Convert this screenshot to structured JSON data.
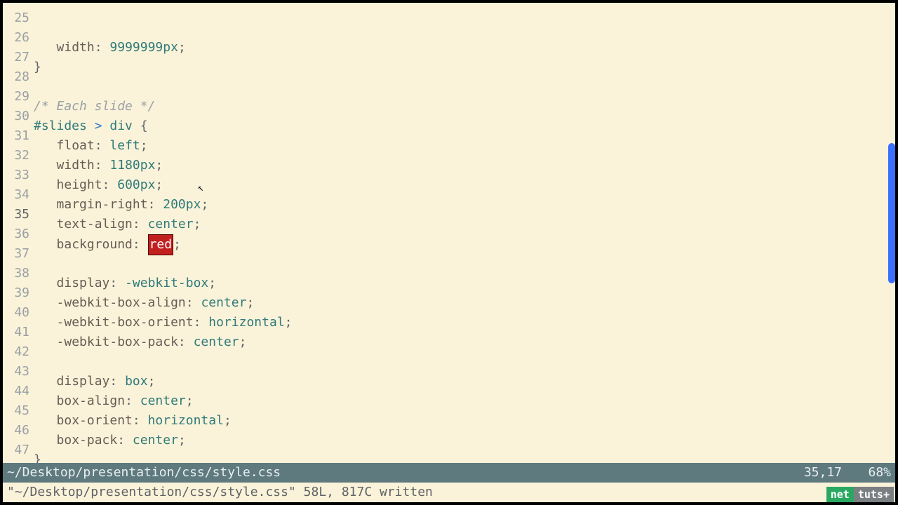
{
  "lines": [
    {
      "n": 25,
      "indent": 1,
      "tokens": [
        {
          "t": "width",
          "c": "prop"
        },
        {
          "t": ": ",
          "c": "punct"
        },
        {
          "t": "9999999px",
          "c": "num"
        },
        {
          "t": ";",
          "c": "punct"
        }
      ]
    },
    {
      "n": 26,
      "indent": 0,
      "tokens": [
        {
          "t": "}",
          "c": "punct"
        }
      ]
    },
    {
      "n": 27,
      "indent": 0,
      "tokens": []
    },
    {
      "n": 28,
      "indent": 0,
      "tokens": [
        {
          "t": "/* Each slide */",
          "c": "comment"
        }
      ]
    },
    {
      "n": 29,
      "indent": 0,
      "tokens": [
        {
          "t": "#slides",
          "c": "kw"
        },
        {
          "t": " > ",
          "c": "sel-blue"
        },
        {
          "t": "div",
          "c": "kw"
        },
        {
          "t": " {",
          "c": "punct"
        }
      ]
    },
    {
      "n": 30,
      "indent": 1,
      "tokens": [
        {
          "t": "float",
          "c": "prop"
        },
        {
          "t": ": ",
          "c": "punct"
        },
        {
          "t": "left",
          "c": "kw"
        },
        {
          "t": ";",
          "c": "punct"
        }
      ]
    },
    {
      "n": 31,
      "indent": 1,
      "tokens": [
        {
          "t": "width",
          "c": "prop"
        },
        {
          "t": ": ",
          "c": "punct"
        },
        {
          "t": "1180px",
          "c": "num"
        },
        {
          "t": ";",
          "c": "punct"
        }
      ]
    },
    {
      "n": 32,
      "indent": 1,
      "tokens": [
        {
          "t": "height",
          "c": "prop"
        },
        {
          "t": ": ",
          "c": "punct"
        },
        {
          "t": "600px",
          "c": "num"
        },
        {
          "t": ";",
          "c": "punct"
        }
      ]
    },
    {
      "n": 33,
      "indent": 1,
      "tokens": [
        {
          "t": "margin-right",
          "c": "prop"
        },
        {
          "t": ": ",
          "c": "punct"
        },
        {
          "t": "200px",
          "c": "num"
        },
        {
          "t": ";",
          "c": "punct"
        }
      ]
    },
    {
      "n": 34,
      "indent": 1,
      "tokens": [
        {
          "t": "text-align",
          "c": "prop"
        },
        {
          "t": ": ",
          "c": "punct"
        },
        {
          "t": "center",
          "c": "kw"
        },
        {
          "t": ";",
          "c": "punct"
        }
      ]
    },
    {
      "n": 35,
      "indent": 1,
      "cur": true,
      "tokens": [
        {
          "t": "background",
          "c": "prop"
        },
        {
          "t": ": ",
          "c": "punct"
        },
        {
          "t": "red",
          "c": "highlight"
        },
        {
          "t": ";",
          "c": "punct"
        }
      ]
    },
    {
      "n": 36,
      "indent": 0,
      "tokens": []
    },
    {
      "n": 37,
      "indent": 1,
      "tokens": [
        {
          "t": "display",
          "c": "prop"
        },
        {
          "t": ": ",
          "c": "punct"
        },
        {
          "t": "-webkit-box",
          "c": "kw"
        },
        {
          "t": ";",
          "c": "punct"
        }
      ]
    },
    {
      "n": 38,
      "indent": 1,
      "tokens": [
        {
          "t": "-webkit-box-align",
          "c": "prop"
        },
        {
          "t": ": ",
          "c": "punct"
        },
        {
          "t": "center",
          "c": "kw"
        },
        {
          "t": ";",
          "c": "punct"
        }
      ]
    },
    {
      "n": 39,
      "indent": 1,
      "tokens": [
        {
          "t": "-webkit-box-orient",
          "c": "prop"
        },
        {
          "t": ": ",
          "c": "punct"
        },
        {
          "t": "horizontal",
          "c": "kw"
        },
        {
          "t": ";",
          "c": "punct"
        }
      ]
    },
    {
      "n": 40,
      "indent": 1,
      "tokens": [
        {
          "t": "-webkit-box-pack",
          "c": "prop"
        },
        {
          "t": ": ",
          "c": "punct"
        },
        {
          "t": "center",
          "c": "kw"
        },
        {
          "t": ";",
          "c": "punct"
        }
      ]
    },
    {
      "n": 41,
      "indent": 0,
      "tokens": []
    },
    {
      "n": 42,
      "indent": 1,
      "tokens": [
        {
          "t": "display",
          "c": "prop"
        },
        {
          "t": ": ",
          "c": "punct"
        },
        {
          "t": "box",
          "c": "kw"
        },
        {
          "t": ";",
          "c": "punct"
        }
      ]
    },
    {
      "n": 43,
      "indent": 1,
      "tokens": [
        {
          "t": "box-align",
          "c": "prop"
        },
        {
          "t": ": ",
          "c": "punct"
        },
        {
          "t": "center",
          "c": "kw"
        },
        {
          "t": ";",
          "c": "punct"
        }
      ]
    },
    {
      "n": 44,
      "indent": 1,
      "tokens": [
        {
          "t": "box-orient",
          "c": "prop"
        },
        {
          "t": ": ",
          "c": "punct"
        },
        {
          "t": "horizontal",
          "c": "kw"
        },
        {
          "t": ";",
          "c": "punct"
        }
      ]
    },
    {
      "n": 45,
      "indent": 1,
      "tokens": [
        {
          "t": "box-pack",
          "c": "prop"
        },
        {
          "t": ": ",
          "c": "punct"
        },
        {
          "t": "center",
          "c": "kw"
        },
        {
          "t": ";",
          "c": "punct"
        }
      ]
    },
    {
      "n": 46,
      "indent": 0,
      "tokens": [
        {
          "t": "}",
          "c": "punct"
        }
      ]
    },
    {
      "n": 47,
      "indent": 0,
      "tokens": []
    }
  ],
  "status": {
    "path": "~/Desktop/presentation/css/style.css",
    "pos": "35,17",
    "pct": "68%"
  },
  "message": "\"~/Desktop/presentation/css/style.css\" 58L, 817C written",
  "watermark": {
    "left": "net",
    "right": "tuts+"
  }
}
